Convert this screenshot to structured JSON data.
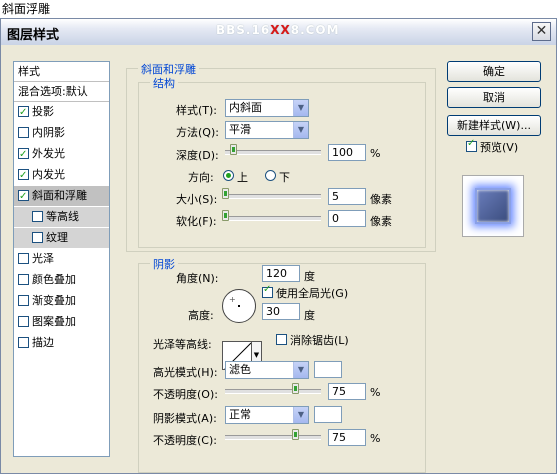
{
  "caption": "斜面浮雕",
  "window": {
    "title": "图层样式",
    "watermark_prefix": "BBS.16",
    "watermark_x": "XX",
    "watermark_suffix": "8.COM",
    "close_label": "✕"
  },
  "sidebar": {
    "header": "样式",
    "blend": "混合选项:默认",
    "items": [
      {
        "label": "投影",
        "checked": true
      },
      {
        "label": "内阴影",
        "checked": false
      },
      {
        "label": "外发光",
        "checked": true
      },
      {
        "label": "内发光",
        "checked": true
      },
      {
        "label": "斜面和浮雕",
        "checked": true
      },
      {
        "label": "等高线",
        "checked": false
      },
      {
        "label": "纹理",
        "checked": false
      },
      {
        "label": "光泽",
        "checked": false
      },
      {
        "label": "颜色叠加",
        "checked": false
      },
      {
        "label": "渐变叠加",
        "checked": false
      },
      {
        "label": "图案叠加",
        "checked": false
      },
      {
        "label": "描边",
        "checked": false
      }
    ]
  },
  "bevel": {
    "group_title": "斜面和浮雕",
    "structure_title": "结构",
    "style_label": "样式(T):",
    "style_value": "内斜面",
    "technique_label": "方法(Q):",
    "technique_value": "平滑",
    "depth_label": "深度(D):",
    "depth_value": "100",
    "depth_unit": "%",
    "depth_fraction": 0.1,
    "direction_label": "方向:",
    "dir_up": "上",
    "dir_down": "下",
    "size_label": "大小(S):",
    "size_value": "5",
    "size_unit": "像素",
    "soften_label": "软化(F):",
    "soften_value": "0",
    "soften_unit": "像素"
  },
  "shading": {
    "title": "阴影",
    "angle_label": "角度(N):",
    "angle_value": "120",
    "angle_unit": "度",
    "global_light_label": "使用全局光(G)",
    "altitude_label": "高度:",
    "altitude_value": "30",
    "altitude_unit": "度",
    "gloss_label": "光泽等高线:",
    "antialias_label": "消除锯齿(L)",
    "highlight_mode_label": "高光模式(H):",
    "highlight_mode_value": "滤色",
    "highlight_opacity_label": "不透明度(O):",
    "highlight_opacity_value": "75",
    "shadow_mode_label": "阴影模式(A):",
    "shadow_mode_value": "正常",
    "shadow_opacity_label": "不透明度(C):",
    "shadow_opacity_value": "75",
    "pct": "%"
  },
  "buttons": {
    "ok": "确定",
    "cancel": "取消",
    "new_style": "新建样式(W)...",
    "preview": "预览(V)"
  }
}
